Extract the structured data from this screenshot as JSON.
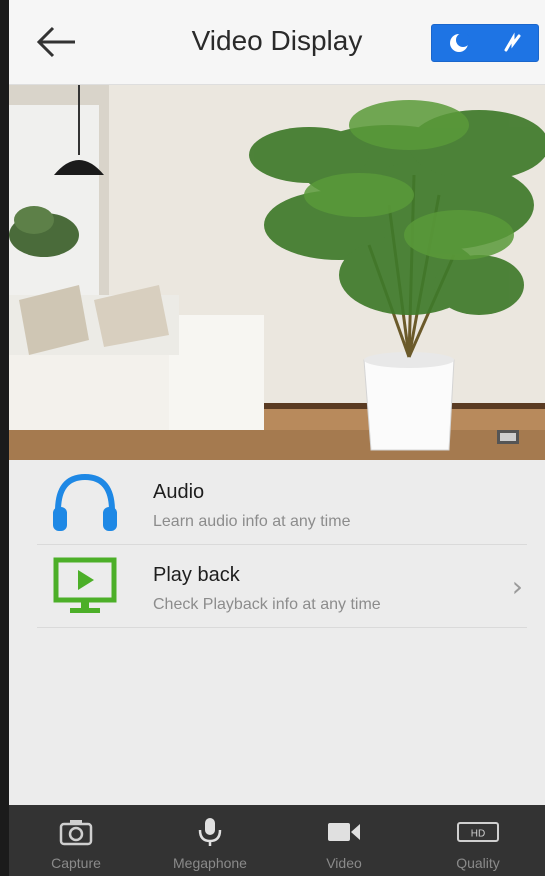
{
  "header": {
    "title": "Video Display",
    "back_icon": "back-arrow-icon",
    "mode_buttons": [
      {
        "icon": "moon-icon",
        "label": "night-mode"
      },
      {
        "icon": "fast-forward-icon",
        "label": "mode-2"
      }
    ]
  },
  "features": [
    {
      "title": "Audio",
      "subtitle": "Learn audio info at any time",
      "icon": "headphones-icon",
      "icon_color": "#1e88e5",
      "has_chevron": false
    },
    {
      "title": "Play back",
      "subtitle": "Check Playback info at any time",
      "icon": "monitor-play-icon",
      "icon_color": "#4caf28",
      "has_chevron": true
    }
  ],
  "bottom_bar": {
    "tabs": [
      {
        "label": "Capture",
        "icon": "camera-icon"
      },
      {
        "label": "Megaphone",
        "icon": "microphone-icon"
      },
      {
        "label": "Video",
        "icon": "video-camera-icon"
      },
      {
        "label": "Quality",
        "icon": "hd-icon",
        "icon_text": "HD"
      }
    ]
  },
  "colors": {
    "accent": "#1e74e4",
    "header_bg": "#f6f6f6",
    "bottom_bar_bg": "#333333",
    "audio_icon": "#1e88e5",
    "playback_icon": "#4caf28"
  }
}
